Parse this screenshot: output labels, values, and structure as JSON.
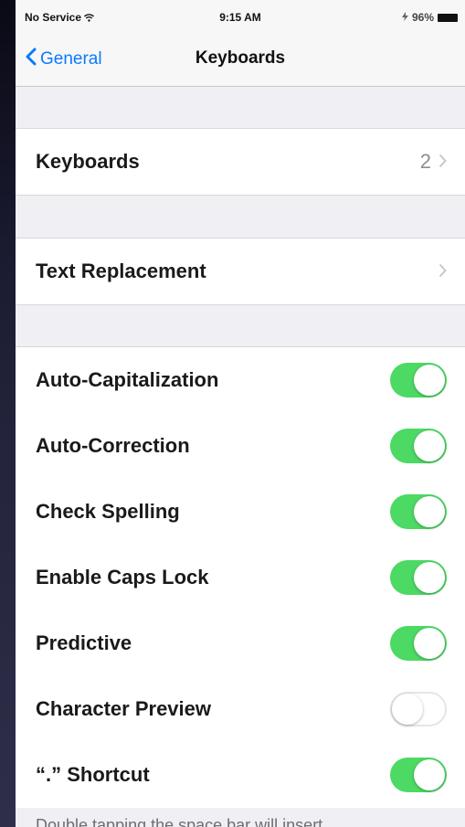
{
  "status_bar": {
    "carrier": "No Service",
    "time": "9:15 AM",
    "battery": "96%"
  },
  "nav": {
    "back_label": "General",
    "title": "Keyboards"
  },
  "group1": {
    "keyboards_label": "Keyboards",
    "keyboards_count": "2"
  },
  "group2": {
    "text_replacement_label": "Text Replacement"
  },
  "settings": [
    {
      "label": "Auto-Capitalization",
      "on": true
    },
    {
      "label": "Auto-Correction",
      "on": true
    },
    {
      "label": "Check Spelling",
      "on": true
    },
    {
      "label": "Enable Caps Lock",
      "on": true
    },
    {
      "label": "Predictive",
      "on": true
    },
    {
      "label": "Character Preview",
      "on": false
    },
    {
      "label": "“.” Shortcut",
      "on": true
    }
  ],
  "footer_text": "Double tapping the space bar will insert",
  "colors": {
    "accent": "#0a7aff",
    "toggle_on": "#4cd964"
  }
}
